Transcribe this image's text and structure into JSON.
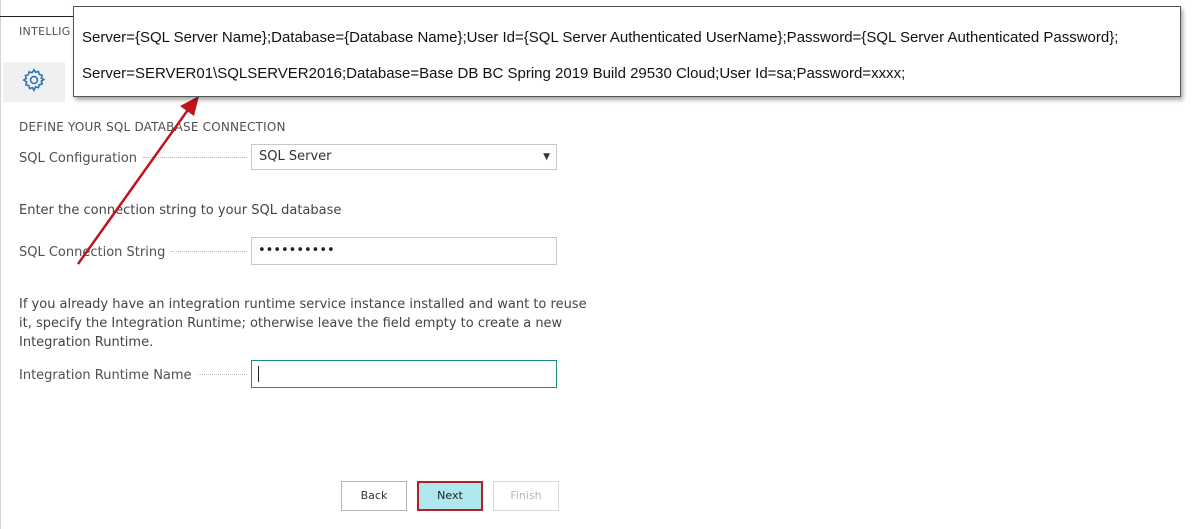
{
  "header": {
    "title": "INTELLIG"
  },
  "icons": {
    "settings": "gear-icon"
  },
  "section": {
    "title": "DEFINE YOUR SQL DATABASE CONNECTION"
  },
  "sql_configuration": {
    "label": "SQL Configuration",
    "value": "SQL Server"
  },
  "connection_string": {
    "instruction": "Enter the connection string to your SQL database",
    "label": "SQL Connection String",
    "value": "••••••••••"
  },
  "integration_runtime": {
    "instruction_line1": "If you already have an integration runtime service instance installed and want to reuse",
    "instruction_line2": "it, specify the Integration Runtime; otherwise leave the field empty to create a new",
    "instruction_line3": "Integration Runtime.",
    "label": "Integration Runtime Name",
    "value": ""
  },
  "buttons": {
    "back": "Back",
    "next": "Next",
    "finish": "Finish"
  },
  "tooltip": {
    "template": "Server={SQL Server Name};Database={Database Name};User Id={SQL Server Authenticated UserName};Password={SQL Server Authenticated Password};",
    "example": "Server=SERVER01\\SQLSERVER2016;Database=Base DB BC Spring 2019 Build 29530 Cloud;User Id=sa;Password=xxxx;"
  },
  "colors": {
    "annotation": "#c0151b",
    "next_bg": "#aee8ee",
    "focus_border": "#1a8a8a"
  }
}
